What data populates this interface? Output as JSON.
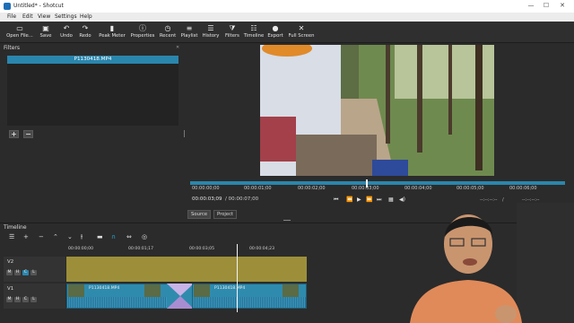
{
  "window": {
    "title": "Untitled* - Shotcut",
    "controls": {
      "minimize": "—",
      "maximize": "☐",
      "close": "✕"
    }
  },
  "menu": [
    "File",
    "Edit",
    "View",
    "Settings",
    "Help"
  ],
  "toolbar": [
    {
      "label": "Open File...",
      "icon": "folder-open-icon",
      "glyph": "▭"
    },
    {
      "label": "Save",
      "icon": "save-icon",
      "glyph": "▣"
    },
    {
      "label": "Undo",
      "icon": "undo-icon",
      "glyph": "↶"
    },
    {
      "label": "Redo",
      "icon": "redo-icon",
      "glyph": "↷"
    },
    {
      "label": "Peak Meter",
      "icon": "peak-meter-icon",
      "glyph": "▮"
    },
    {
      "label": "Properties",
      "icon": "properties-icon",
      "glyph": "ⓘ"
    },
    {
      "label": "Recent",
      "icon": "recent-icon",
      "glyph": "◷"
    },
    {
      "label": "Playlist",
      "icon": "playlist-icon",
      "glyph": "≡"
    },
    {
      "label": "History",
      "icon": "history-icon",
      "glyph": "☰"
    },
    {
      "label": "Filters",
      "icon": "filter-icon",
      "glyph": "⧩"
    },
    {
      "label": "Timeline",
      "icon": "timeline-icon",
      "glyph": "☷"
    },
    {
      "label": "Export",
      "icon": "export-icon",
      "glyph": "●"
    },
    {
      "label": "Full Screen",
      "icon": "fullscreen-icon",
      "glyph": "✕"
    }
  ],
  "filters": {
    "title": "Filters",
    "clip_name": "P1130418.MP4",
    "add": "+",
    "remove": "−"
  },
  "player": {
    "ruler_timecodes": [
      "00:00:00;00",
      "00:00:01;00",
      "00:00:02;00",
      "00:00:03;00",
      "00:00:04;00",
      "00:00:05;00",
      "00:00:06;00"
    ],
    "current_time": "00:00:03;09",
    "total_time": "/ 00:00:07;00",
    "in_point": "--:--:--:--",
    "out_point": "--:--:--:--",
    "tabs": [
      "Source",
      "Project"
    ]
  },
  "timeline": {
    "title": "Timeline",
    "ruler_timecodes": [
      "00:00:00;00",
      "00:00:01;17",
      "00:00:03;05",
      "00:00:04;23"
    ],
    "tracks": [
      {
        "name": "V2",
        "buttons": [
          "M",
          "H",
          "C",
          "L"
        ]
      },
      {
        "name": "V1",
        "buttons": [
          "M",
          "H",
          "C",
          "L"
        ]
      }
    ],
    "clips": [
      "P1130418.MP4",
      "P1130418.MP4"
    ]
  },
  "colors": {
    "accent": "#2a86ad",
    "v2_track": "#9d8f3a",
    "clip": "#2f8bae",
    "transition": "#b79fd6"
  }
}
